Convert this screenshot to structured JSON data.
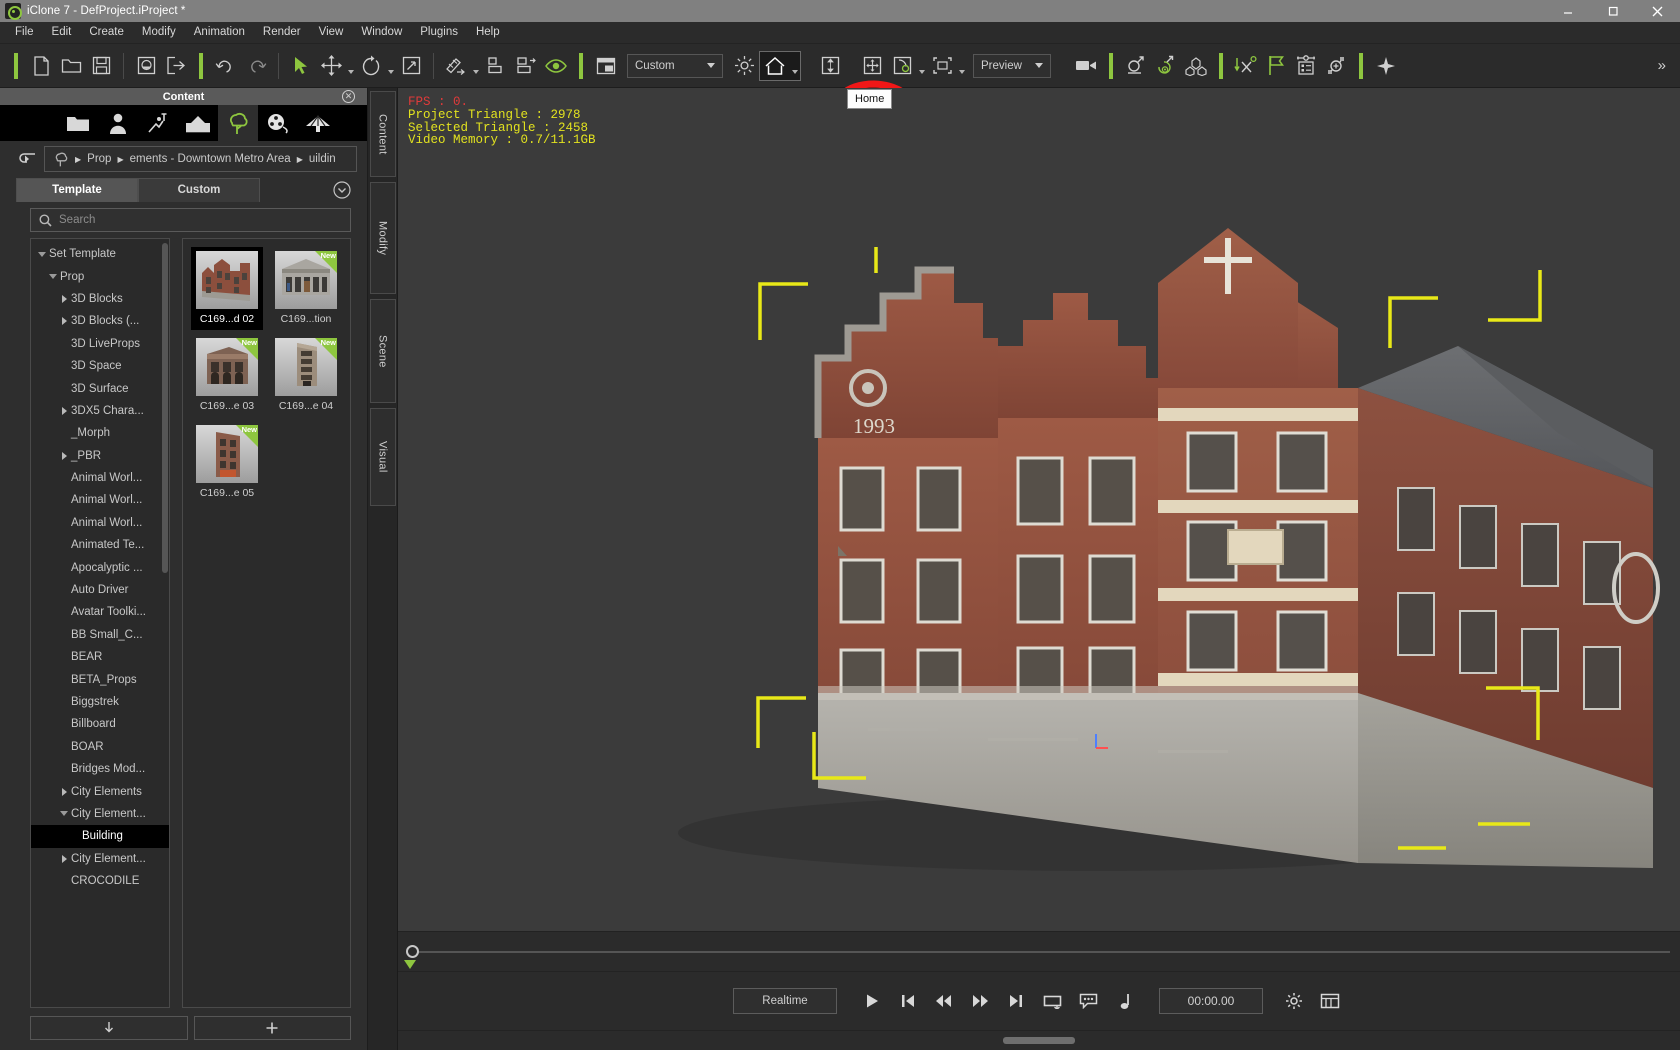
{
  "window": {
    "title": "iClone 7 - DefProject.iProject *",
    "logo_icon": "iclone-logo-icon",
    "minimize_icon": "minimize-icon",
    "maximize_icon": "maximize-icon",
    "close_icon": "close-icon"
  },
  "menubar": {
    "items": [
      {
        "label": "File"
      },
      {
        "label": "Edit"
      },
      {
        "label": "Create"
      },
      {
        "label": "Modify"
      },
      {
        "label": "Animation"
      },
      {
        "label": "Render"
      },
      {
        "label": "View"
      },
      {
        "label": "Window"
      },
      {
        "label": "Plugins"
      },
      {
        "label": "Help"
      }
    ]
  },
  "toolbar": {
    "new_label": "New Project",
    "open_label": "Open Project",
    "save_label": "Save Project",
    "load_label": "Load",
    "export_label": "Export",
    "undo_label": "Undo",
    "redo_label": "Redo",
    "select_label": "Select",
    "move_label": "Move",
    "rotate_label": "Rotate",
    "scale_label": "Scale",
    "align_label": "Align",
    "snap_label": "Snap",
    "snap2_label": "Snap Settings",
    "eye_label": "Show/Hide",
    "layout_label": "Layout",
    "view_preset_value": "Custom",
    "light_label": "Light",
    "home_label": "Home",
    "ground_label": "Move to Ground",
    "transform_label": "Transform",
    "pivot_label": "Pivot",
    "bounding_label": "Bounding Box",
    "quality_value": "Preview",
    "camera_label": "Camera",
    "physics_label": "Physics",
    "softcloth_label": "Soft Cloth",
    "particle_label": "Particle",
    "path_label": "Motion Path",
    "flag_label": "Flag",
    "list_label": "Scene List",
    "spring_label": "Spring",
    "star_label": "Favorites",
    "overflow_label": "More"
  },
  "annotation": {
    "shape": "red-circle-highlight",
    "color": "#f01717",
    "target": "home-button"
  },
  "tooltip": {
    "text": "Home"
  },
  "content_panel": {
    "title": "Content",
    "close_icon": "close-icon",
    "categories": [
      {
        "name": "folder-icon",
        "active": false
      },
      {
        "name": "actor-icon",
        "active": false
      },
      {
        "name": "motion-icon",
        "active": false
      },
      {
        "name": "stage-icon",
        "active": false
      },
      {
        "name": "prop-tree-icon",
        "active": true
      },
      {
        "name": "media-reel-icon",
        "active": false
      },
      {
        "name": "particle-icon",
        "active": false
      }
    ],
    "back_icon": "back-arrow-icon",
    "breadcrumb": {
      "root_icon": "prop-tree-icon",
      "parts": [
        "Prop",
        "ements - Downtown Metro Area",
        "uildin"
      ]
    },
    "tabs": [
      {
        "label": "Template",
        "active": true
      },
      {
        "label": "Custom",
        "active": false
      }
    ],
    "rollup_icon": "chevron-down-circle-icon",
    "search": {
      "placeholder": "Search",
      "value": "",
      "icon": "search-icon"
    },
    "tree": [
      {
        "label": "Set Template",
        "indent": 0,
        "arrow": "open",
        "selected": false
      },
      {
        "label": "Prop",
        "indent": 1,
        "arrow": "open",
        "selected": false
      },
      {
        "label": "3D Blocks",
        "indent": 2,
        "arrow": "closed",
        "selected": false
      },
      {
        "label": "3D Blocks (...",
        "indent": 2,
        "arrow": "closed",
        "selected": false
      },
      {
        "label": "3D LiveProps",
        "indent": 2,
        "arrow": "none",
        "selected": false
      },
      {
        "label": "3D Space",
        "indent": 2,
        "arrow": "none",
        "selected": false
      },
      {
        "label": "3D Surface",
        "indent": 2,
        "arrow": "none",
        "selected": false
      },
      {
        "label": "3DX5 Chara...",
        "indent": 2,
        "arrow": "closed",
        "selected": false
      },
      {
        "label": "_Morph",
        "indent": 2,
        "arrow": "none",
        "selected": false
      },
      {
        "label": "_PBR",
        "indent": 2,
        "arrow": "closed",
        "selected": false
      },
      {
        "label": "Animal Worl...",
        "indent": 2,
        "arrow": "none",
        "selected": false
      },
      {
        "label": "Animal Worl...",
        "indent": 2,
        "arrow": "none",
        "selected": false
      },
      {
        "label": "Animal Worl...",
        "indent": 2,
        "arrow": "none",
        "selected": false
      },
      {
        "label": "Animated Te...",
        "indent": 2,
        "arrow": "none",
        "selected": false
      },
      {
        "label": "Apocalyptic ...",
        "indent": 2,
        "arrow": "none",
        "selected": false
      },
      {
        "label": "Auto Driver",
        "indent": 2,
        "arrow": "none",
        "selected": false
      },
      {
        "label": "Avatar Toolki...",
        "indent": 2,
        "arrow": "none",
        "selected": false
      },
      {
        "label": "BB Small_C...",
        "indent": 2,
        "arrow": "none",
        "selected": false
      },
      {
        "label": "BEAR",
        "indent": 2,
        "arrow": "none",
        "selected": false
      },
      {
        "label": "BETA_Props",
        "indent": 2,
        "arrow": "none",
        "selected": false
      },
      {
        "label": "Biggstrek",
        "indent": 2,
        "arrow": "none",
        "selected": false
      },
      {
        "label": "Billboard",
        "indent": 2,
        "arrow": "none",
        "selected": false
      },
      {
        "label": "BOAR",
        "indent": 2,
        "arrow": "none",
        "selected": false
      },
      {
        "label": "Bridges Mod...",
        "indent": 2,
        "arrow": "none",
        "selected": false
      },
      {
        "label": "City Elements",
        "indent": 2,
        "arrow": "closed",
        "selected": false
      },
      {
        "label": "City Element...",
        "indent": 2,
        "arrow": "open",
        "selected": false
      },
      {
        "label": "Building",
        "indent": 3,
        "arrow": "none",
        "selected": true
      },
      {
        "label": "City Element...",
        "indent": 2,
        "arrow": "closed",
        "selected": false
      },
      {
        "label": "CROCODILE",
        "indent": 2,
        "arrow": "none",
        "selected": false
      }
    ],
    "thumbnails": [
      {
        "caption": "C169...d 02",
        "new": false,
        "selected": true,
        "kind": "brick-rowhouse"
      },
      {
        "caption": "C169...tion",
        "new": true,
        "selected": false,
        "kind": "grey-station"
      },
      {
        "caption": "C169...e 03",
        "new": true,
        "selected": false,
        "kind": "brown-block"
      },
      {
        "caption": "C169...e 04",
        "new": true,
        "selected": false,
        "kind": "tall-tower"
      },
      {
        "caption": "C169...e 05",
        "new": true,
        "selected": false,
        "kind": "narrow-walkup"
      }
    ],
    "new_badge_label": "New",
    "footer": {
      "download_icon": "download-arrow-icon",
      "add_icon": "plus-icon"
    }
  },
  "vertical_tabs": [
    {
      "label": "Content",
      "active": true
    },
    {
      "label": "Modify",
      "active": false
    },
    {
      "label": "Scene",
      "active": false
    },
    {
      "label": "Visual",
      "active": false
    }
  ],
  "viewport": {
    "stats": {
      "fps": "FPS : 0.",
      "project_triangle": "Project Triangle : 2978",
      "selected_triangle": "Selected Triangle : 2458",
      "video_memory": "Video Memory : 0.7/11.1GB"
    },
    "fps_color": "#e03a3a",
    "stats_color": "#e2e21f",
    "selection_color": "#e8e818",
    "background_color": "#3b3b3b",
    "scene_object": "brick-building-row"
  },
  "timeline": {
    "playhead_position": "0",
    "marker_icon": "keyframe-marker-icon"
  },
  "playbar": {
    "mode_label": "Realtime",
    "buttons": [
      {
        "name": "play-button",
        "icon": "play-icon"
      },
      {
        "name": "jump-to-start-button",
        "icon": "skip-back-icon"
      },
      {
        "name": "rewind-button",
        "icon": "rewind-icon"
      },
      {
        "name": "fast-forward-button",
        "icon": "fast-forward-icon"
      },
      {
        "name": "jump-to-end-button",
        "icon": "skip-forward-icon"
      },
      {
        "name": "loop-button",
        "icon": "loop-icon"
      },
      {
        "name": "subtitle-button",
        "icon": "speech-bubble-icon"
      },
      {
        "name": "audio-button",
        "icon": "music-note-icon"
      }
    ],
    "timecode": "00:00.00",
    "right_buttons": [
      {
        "name": "playback-settings-button",
        "icon": "gear-icon"
      },
      {
        "name": "timeline-button",
        "icon": "timeline-icon"
      }
    ]
  }
}
